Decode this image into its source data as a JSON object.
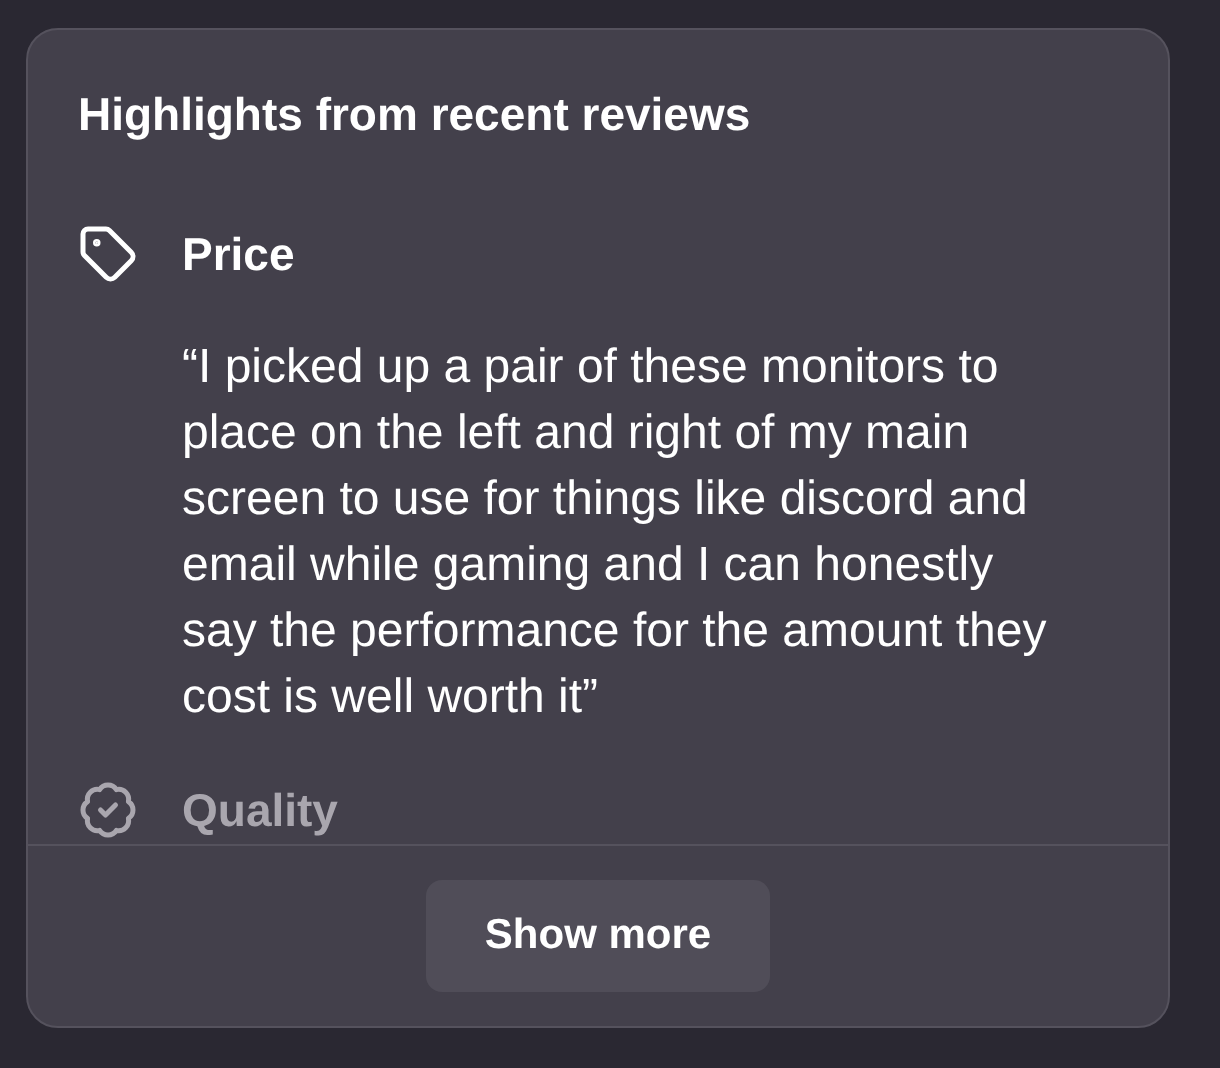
{
  "title": "Highlights from recent reviews",
  "highlights": [
    {
      "kind": "tag",
      "label": "Price",
      "quote": "“I picked up a pair of these monitors to place on the left and right of my main screen to use for things like discord and email while gaming and I can honestly say the performance for the amount they cost is well worth it”",
      "faded": false
    },
    {
      "kind": "badge",
      "label": "Quality",
      "faded": true
    }
  ],
  "button": "Show more"
}
